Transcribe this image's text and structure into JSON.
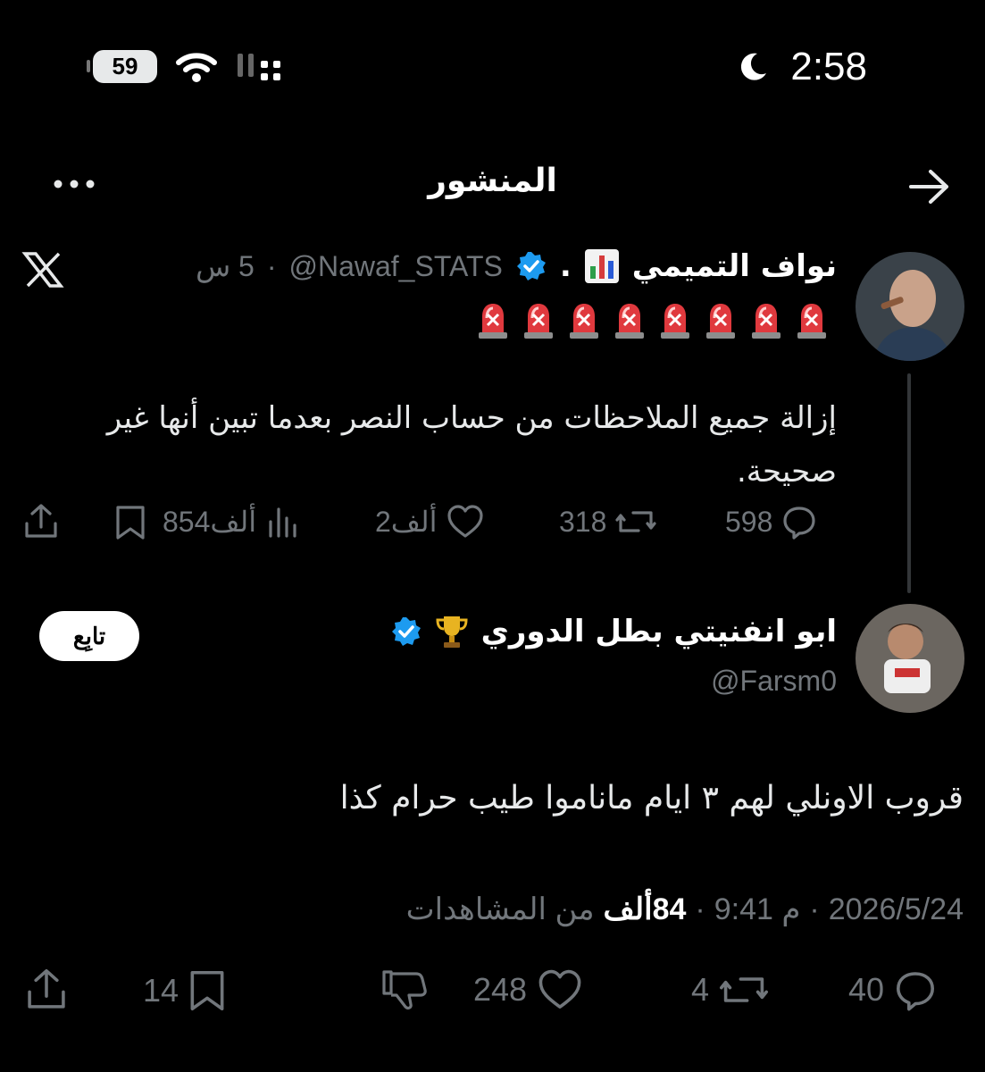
{
  "status_bar": {
    "battery": "59",
    "time": "2:58"
  },
  "header": {
    "title": "المنشور"
  },
  "quoted_post": {
    "author_name": "نواف التميمي",
    "author_suffix": ".",
    "handle": "@Nawaf_STATS",
    "time": "5 س",
    "separator": "·",
    "body": "إزالة جميع الملاحظات من حساب النصر بعدما تبين أنها غير صحيحة.",
    "metrics": {
      "replies": "598",
      "reposts": "318",
      "likes": "2ألف",
      "views": "854ألف"
    }
  },
  "reply_post": {
    "author_name": "ابو انفنيتي بطل الدوري",
    "handle": "@Farsm0",
    "follow_label": "تابِع",
    "body": "قروب الاونلي لهم ٣ ايام ماناموا طيب حرام كذا",
    "date": "2026/5/24",
    "time": "9:41 م",
    "views_count": "84ألف",
    "views_label": "من المشاهدات",
    "metrics": {
      "replies": "40",
      "reposts": "4",
      "likes": "248",
      "bookmarks": "14"
    }
  },
  "colors": {
    "background": "#000000",
    "text": "#e7e9ea",
    "muted": "#71767b",
    "verified": "#1d9bf0"
  }
}
